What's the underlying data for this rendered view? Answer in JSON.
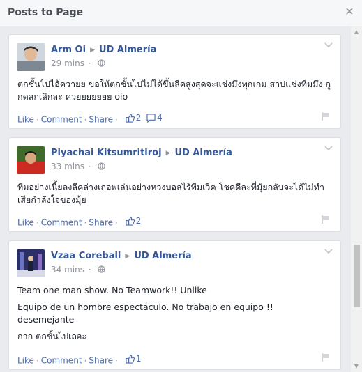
{
  "dialog": {
    "title": "Posts to Page",
    "close_glyph": "✕"
  },
  "posts": [
    {
      "author": "Arm Oi",
      "page": "UD Almería",
      "time": "29 mins",
      "text": [
        "ตกชั้นไปไอ้ควายย ขอให้ตกชั้นไปไม่ได้ขึ้นลีคสูงสุดจะแช่งมึงทุกเกม สาปแช่งทีมมึง กูกดลกเลิกละ ควยยยยยยย oio"
      ],
      "like_label": "Like",
      "comment_label": "Comment",
      "share_label": "Share",
      "like_count": "2",
      "comment_count": "4"
    },
    {
      "author": "Piyachai Kitsumritiroj",
      "page": "UD Almería",
      "time": "33 mins",
      "text": [
        "ทีมอย่างเนี้ยลงลีคล่างเถอพเล่นอย่างหวงบอลไร้ทีมเวิค โชคดีละที่มุ้ยกลับจะได้ไม่ทำเสียกำลังใจของมุ้ย"
      ],
      "like_label": "Like",
      "comment_label": "Comment",
      "share_label": "Share",
      "like_count": "2"
    },
    {
      "author": "Vzaa Coreball",
      "page": "UD Almería",
      "time": "34 mins",
      "text": [
        "Team one man show. No Teamwork!! Unlike",
        "Equipo de un hombre espectáculo. No trabajo en equipo !! desemejante",
        "กาก ตกชั้นไปเถอะ"
      ],
      "like_label": "Like",
      "comment_label": "Comment",
      "share_label": "Share",
      "like_count": "1"
    }
  ],
  "colors": {
    "link": "#365899",
    "action": "#4b6aa8",
    "meta": "#90949c",
    "background": "#e9ebee"
  }
}
